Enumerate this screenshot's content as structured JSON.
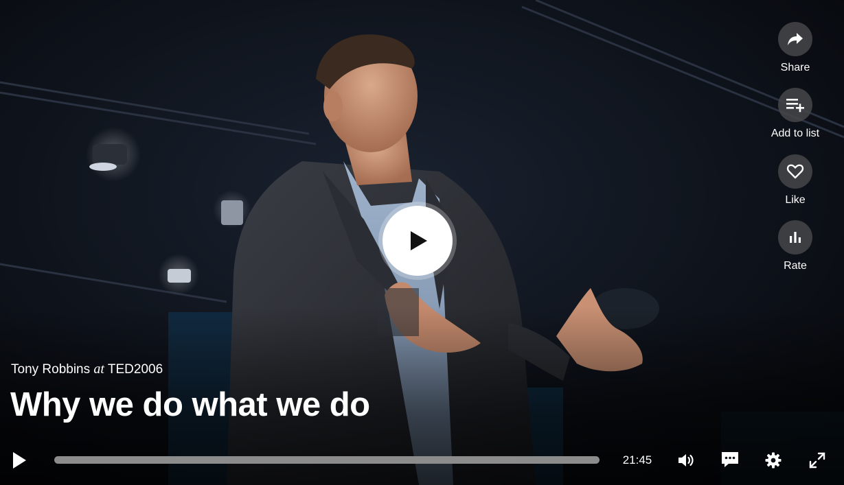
{
  "talk": {
    "speaker": "Tony Robbins",
    "at": "at",
    "event": "TED2006",
    "title": "Why we do what we do"
  },
  "actions": [
    {
      "label": "Share",
      "icon": "share-icon"
    },
    {
      "label": "Add to list",
      "icon": "playlist-add-icon"
    },
    {
      "label": "Like",
      "icon": "heart-icon"
    },
    {
      "label": "Rate",
      "icon": "bar-chart-icon"
    }
  ],
  "controls": {
    "duration": "21:45",
    "progress_fraction": 0,
    "icons": [
      "play-icon",
      "volume-icon",
      "captions-icon",
      "settings-icon",
      "fullscreen-icon"
    ]
  },
  "colors": {
    "accent": "#e62b1e",
    "track": "#8c8c8c",
    "action_circle": "#46464a"
  }
}
